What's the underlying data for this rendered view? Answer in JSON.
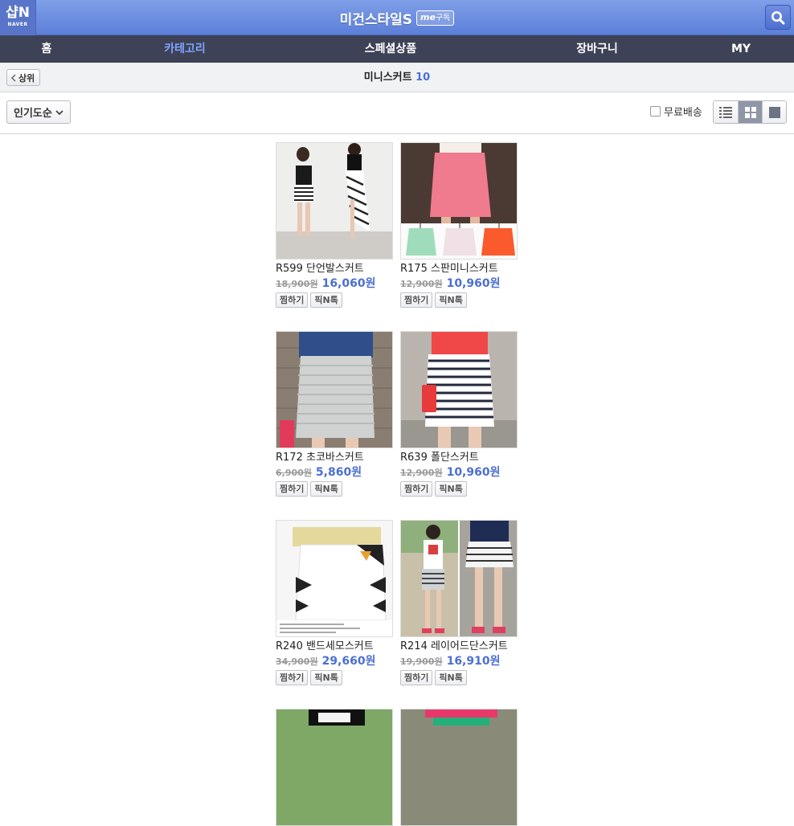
{
  "header": {
    "logo_text": "샵N",
    "logo_sub": "NAVER",
    "store_name": "미건스타일S",
    "me_badge_me": "me",
    "me_badge_label": "구독"
  },
  "nav": {
    "items": [
      {
        "label": "홈"
      },
      {
        "label": "카테고리"
      },
      {
        "label": "스페셜상품"
      },
      {
        "label": "장바구니"
      },
      {
        "label": "MY"
      }
    ],
    "active_index": 1
  },
  "subheader": {
    "back_label": "상위",
    "category": "미니스커트",
    "count": "10"
  },
  "toolbar": {
    "sort_label": "인기도순",
    "free_shipping_label": "무료배송",
    "free_shipping_checked": false,
    "view_modes": [
      "list-view-icon",
      "grid-view-icon",
      "single-view-icon"
    ],
    "active_view": 1
  },
  "colors": {
    "accent": "#4b6fd3",
    "nav_bg": "#3d4256",
    "nav_active": "#7fa4ff",
    "header_bg": "#6f8fe0"
  },
  "products": [
    {
      "name": "R599 단언발스커트",
      "orig_price": "18,900원",
      "sale_price": "16,060원",
      "wish_label": "찜하기",
      "pick_label": "픽N톡",
      "image": "striped-asymmetric-skirt-photo"
    },
    {
      "name": "R175 스판미니스커트",
      "orig_price": "12,900원",
      "sale_price": "10,960원",
      "wish_label": "찜하기",
      "pick_label": "픽N톡",
      "image": "pink-mini-skirt-photo"
    },
    {
      "name": "R172 초코바스커트",
      "orig_price": "6,900원",
      "sale_price": "5,860원",
      "wish_label": "찜하기",
      "pick_label": "픽N톡",
      "image": "grey-stripe-skirt-photo"
    },
    {
      "name": "R639 폴단스커트",
      "orig_price": "12,900원",
      "sale_price": "10,960원",
      "wish_label": "찜하기",
      "pick_label": "픽N톡",
      "image": "navy-stripe-skirt-photo"
    },
    {
      "name": "R240 밴드세모스커트",
      "orig_price": "34,900원",
      "sale_price": "29,660원",
      "wish_label": "찜하기",
      "pick_label": "픽N톡",
      "image": "white-band-skirt-photo"
    },
    {
      "name": "R214 레이어드단스커트",
      "orig_price": "19,900원",
      "sale_price": "16,910원",
      "wish_label": "찜하기",
      "pick_label": "픽N톡",
      "image": "layered-skirt-photo"
    },
    {
      "image": "partial-product-photo"
    },
    {
      "image": "partial-product-photo"
    }
  ]
}
